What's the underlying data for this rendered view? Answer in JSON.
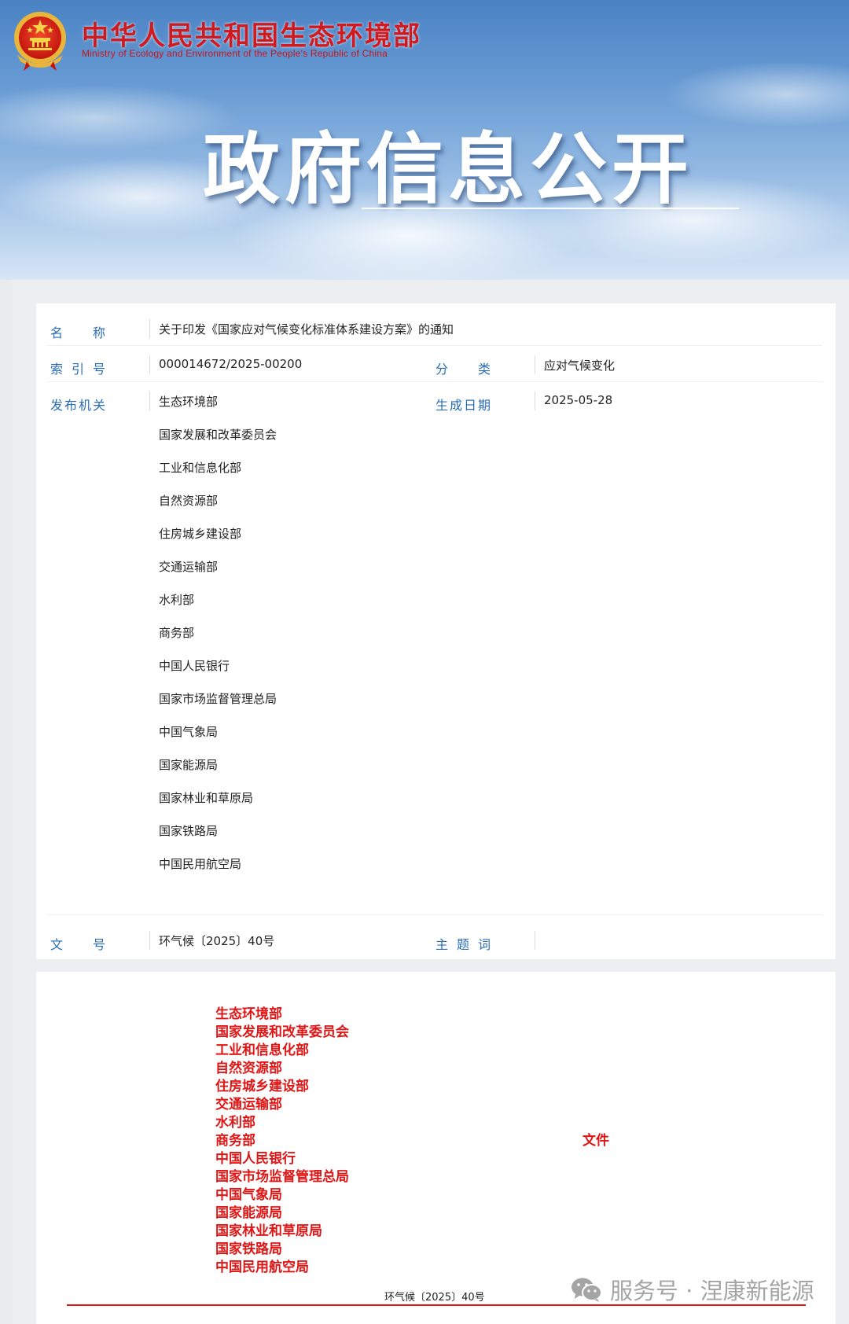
{
  "header": {
    "ministry_cn": "中华人民共和国生态环境部",
    "ministry_en": "Ministry of Ecology and Environment of the People's Republic of China",
    "page_title": "政府信息公开"
  },
  "info": {
    "name_label": "名　称",
    "name_value": "关于印发《国家应对气候变化标准体系建设方案》的通知",
    "index_label": "索 引 号",
    "index_value": "000014672/2025-00200",
    "category_label": "分　类",
    "category_value": "应对气候变化",
    "issuer_label": "发布机关",
    "date_label": "生成日期",
    "date_value": "2025-05-28",
    "issuers": [
      "生态环境部",
      "国家发展和改革委员会",
      "工业和信息化部",
      "自然资源部",
      "住房城乡建设部",
      "交通运输部",
      "水利部",
      "商务部",
      "中国人民银行",
      "国家市场监督管理总局",
      "中国气象局",
      "国家能源局",
      "国家林业和草原局",
      "国家铁路局",
      "中国民用航空局"
    ],
    "docnum_label": "文　号",
    "docnum_value": "环气候〔2025〕40号",
    "keywords_label": "主 题 词",
    "keywords_value": ""
  },
  "document": {
    "orgs": [
      "生态环境部",
      "国家发展和改革委员会",
      "工业和信息化部",
      "自然资源部",
      "住房城乡建设部",
      "交通运输部",
      "水利部",
      "商务部",
      "中国人民银行",
      "国家市场监督管理总局",
      "中国气象局",
      "国家能源局",
      "国家林业和草原局",
      "国家铁路局",
      "中国民用航空局"
    ],
    "file_word": "文件",
    "doc_number": "环气候〔2025〕40号"
  },
  "watermark": {
    "text": "服务号 · 涅康新能源",
    "icon": "wechat-icon"
  },
  "colors": {
    "label_blue": "#2a6db5",
    "doc_red": "#e01515",
    "ministry_red": "#d01a1f"
  }
}
